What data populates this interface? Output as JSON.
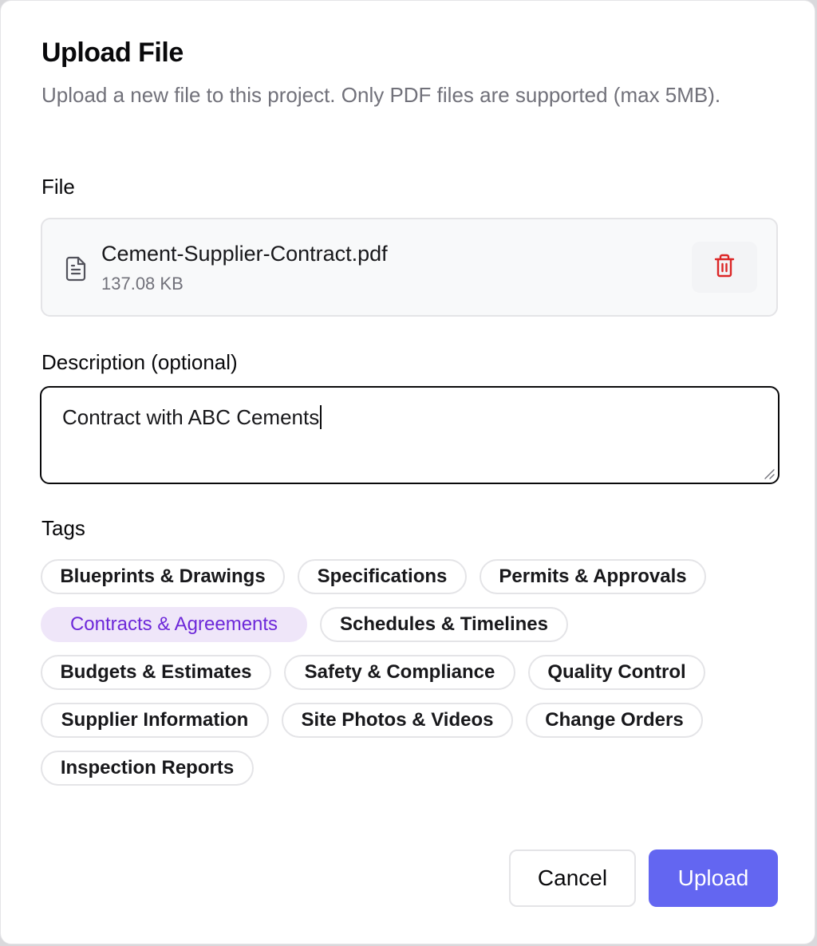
{
  "dialog": {
    "title": "Upload File",
    "subtitle": "Upload a new file to this project. Only PDF files are supported (max 5MB)."
  },
  "file_section": {
    "label": "File",
    "file_name": "Cement-Supplier-Contract.pdf",
    "file_size": "137.08 KB",
    "file_icon": "file-text-icon",
    "delete_icon": "trash-icon",
    "delete_color": "#dc2626"
  },
  "description": {
    "label": "Description (optional)",
    "value": "Contract with ABC Cements"
  },
  "tags": {
    "label": "Tags",
    "items": [
      {
        "label": "Blueprints & Drawings",
        "selected": false
      },
      {
        "label": "Specifications",
        "selected": false
      },
      {
        "label": "Permits & Approvals",
        "selected": false
      },
      {
        "label": "Contracts & Agreements",
        "selected": true
      },
      {
        "label": "Schedules & Timelines",
        "selected": false
      },
      {
        "label": "Budgets & Estimates",
        "selected": false
      },
      {
        "label": "Safety & Compliance",
        "selected": false
      },
      {
        "label": "Quality Control",
        "selected": false
      },
      {
        "label": "Supplier Information",
        "selected": false
      },
      {
        "label": "Site Photos & Videos",
        "selected": false
      },
      {
        "label": "Change Orders",
        "selected": false
      },
      {
        "label": "Inspection Reports",
        "selected": false
      }
    ]
  },
  "actions": {
    "cancel_label": "Cancel",
    "upload_label": "Upload",
    "upload_color": "#6366f1"
  }
}
